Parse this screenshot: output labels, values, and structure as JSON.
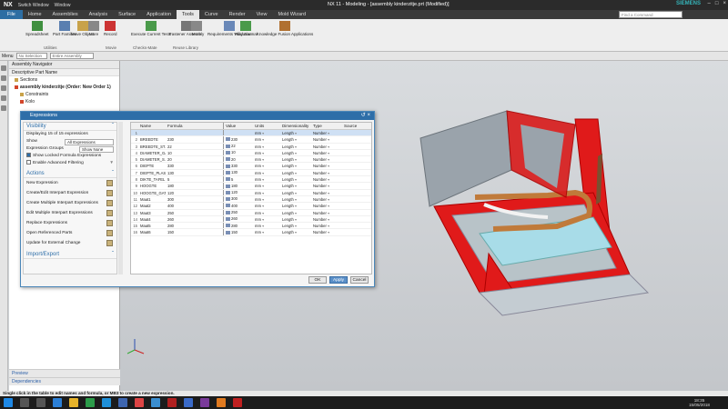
{
  "titlebar": {
    "logo": "NX",
    "switch_window": "Switch Window",
    "window_menu": "Window",
    "title": "NX 11 - Modeling - [assembly kinderzitje.prt (Modified)]",
    "brand": "SIEMENS"
  },
  "menubar": {
    "file": "File",
    "items": [
      "Home",
      "Assemblies",
      "Analysis",
      "Surface",
      "Application",
      "Tools",
      "Curve",
      "Render",
      "View",
      "Mold Wizard"
    ],
    "active": "Tools",
    "find_placeholder": "Find a Command"
  },
  "ribbon": {
    "buttons": [
      "Spreadsheet",
      "Part Families",
      "Move Object",
      "More",
      "Record",
      "Execute Current Tests",
      "Fastener Assembly",
      "More",
      "Requirements Validation",
      "Play Journal",
      "Knowledge Fusion Applications"
    ],
    "groups": [
      "Utilities",
      "Movie",
      "Checks-Mate",
      "Reuse Library"
    ]
  },
  "toolbar2": {
    "menu": "Menu",
    "filter": "No Selection Filter",
    "scope": "Entire Assembly"
  },
  "navigator": {
    "title": "Assembly Navigator",
    "column": "Descriptive Part Name",
    "items": [
      "Sections",
      "assembly kinderzitje (Order: New Order 1)",
      "Constraints",
      "Kolo"
    ],
    "bottom": [
      "Preview",
      "Dependencies"
    ]
  },
  "dialog": {
    "title": "Expressions",
    "visibility": {
      "heading": "Visibility",
      "displaying": "Displaying 15 of 15 expressions",
      "show_label": "Show",
      "show_value": "All Expressions",
      "groups_label": "Expression Groups",
      "groups_value": "Show None",
      "locked": "Show Locked Formula Expressions",
      "advanced": "Enable Advanced Filtering"
    },
    "actions": {
      "heading": "Actions",
      "items": [
        "New Expression",
        "Create/Edit Interpart Expression",
        "Create Multiple Interpart Expressions",
        "Edit Multiple Interpart Expressions",
        "Replace Expressions",
        "Open Referenced Parts",
        "Update for External Change"
      ]
    },
    "import_export": "Import/Export",
    "columns": [
      "",
      "Name",
      "Formula",
      "Value",
      "Units",
      "Dimensionality",
      "Type",
      "Source"
    ],
    "rows": [
      [
        "1",
        "",
        "",
        "",
        "mm",
        "Length",
        "Number",
        ""
      ],
      [
        "2",
        "BREEDTE",
        "230",
        "230",
        "mm",
        "Length",
        "Number",
        ""
      ],
      [
        "3",
        "BREEDTE_ST...",
        "22",
        "22",
        "mm",
        "Length",
        "Number",
        ""
      ],
      [
        "4",
        "DIAMETER_GAT",
        "10",
        "10",
        "mm",
        "Length",
        "Number",
        ""
      ],
      [
        "5",
        "DIAMETER_S...",
        "20",
        "20",
        "mm",
        "Length",
        "Number",
        ""
      ],
      [
        "6",
        "DIEPTE",
        "330",
        "330",
        "mm",
        "Length",
        "Number",
        ""
      ],
      [
        "7",
        "DIEPTE_PLAS",
        "130",
        "130",
        "mm",
        "Length",
        "Number",
        ""
      ],
      [
        "8",
        "DIKTE_TAFEL",
        "5",
        "5",
        "mm",
        "Length",
        "Number",
        ""
      ],
      [
        "9",
        "HOOGTE",
        "180",
        "180",
        "mm",
        "Length",
        "Number",
        ""
      ],
      [
        "10",
        "HOOGTE_GAT",
        "120",
        "120",
        "mm",
        "Length",
        "Number",
        ""
      ],
      [
        "11",
        "Maat1",
        "300",
        "300",
        "mm",
        "Length",
        "Number",
        ""
      ],
      [
        "12",
        "Maat2",
        "400",
        "400",
        "mm",
        "Length",
        "Number",
        ""
      ],
      [
        "13",
        "Maat3",
        "250",
        "250",
        "mm",
        "Length",
        "Number",
        ""
      ],
      [
        "14",
        "Maat4",
        "260",
        "260",
        "mm",
        "Length",
        "Number",
        ""
      ],
      [
        "15",
        "Maat5",
        "280",
        "280",
        "mm",
        "Length",
        "Number",
        ""
      ],
      [
        "16",
        "Maat6",
        "150",
        "150",
        "mm",
        "Length",
        "Number",
        ""
      ]
    ],
    "buttons": {
      "ok": "OK",
      "apply": "Apply",
      "cancel": "Cancel"
    }
  },
  "status": "Single click in the table to edit names and formula, or MB3 to create a new expression.",
  "clock": {
    "time": "18:35",
    "date": "15/05/2018"
  },
  "colors": {
    "accent": "#2e6ea8",
    "part_red": "#e01a1a",
    "part_gray": "#9aa3ab",
    "pipe": "#c07a3a"
  }
}
